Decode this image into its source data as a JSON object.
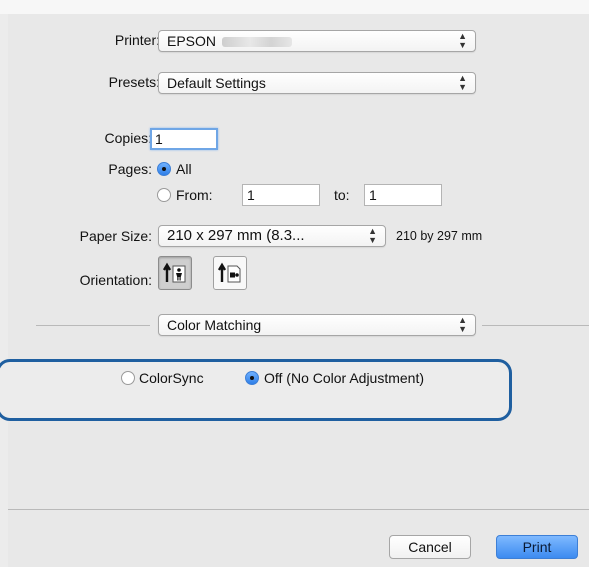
{
  "printer": {
    "label": "Printer:",
    "value": "EPSON"
  },
  "presets": {
    "label": "Presets:",
    "value": "Default Settings"
  },
  "copies": {
    "label": "Copies:",
    "value": "1"
  },
  "pages": {
    "label": "Pages:",
    "all_label": "All",
    "from_label": "From:",
    "from_value": "1",
    "to_label": "to:",
    "to_value": "1",
    "selected": "All"
  },
  "paper_size": {
    "label": "Paper Size:",
    "value": "210 x 297 mm (8.3...",
    "detail": "210 by 297 mm"
  },
  "orientation": {
    "label": "Orientation:",
    "selected": "portrait"
  },
  "section_popup": {
    "value": "Color Matching"
  },
  "color_matching": {
    "option1": "ColorSync",
    "option2": "Off (No Color Adjustment)",
    "selected": "Off (No Color Adjustment)"
  },
  "buttons": {
    "cancel": "Cancel",
    "print": "Print"
  },
  "colors": {
    "accent": "#3c8bf0",
    "highlight_border": "#1f5fa0"
  }
}
